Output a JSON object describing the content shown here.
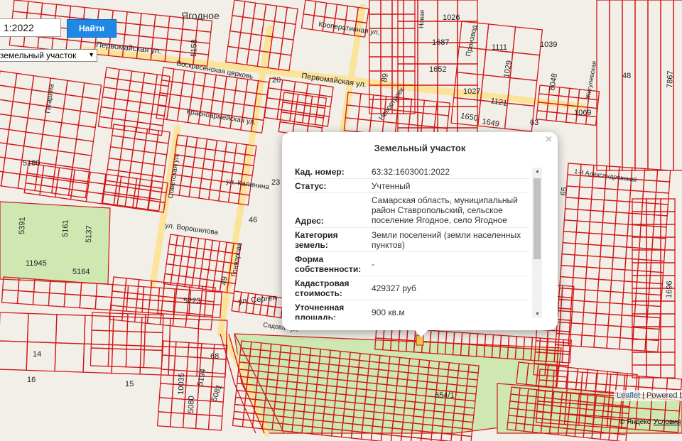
{
  "search": {
    "value": "1:2022",
    "button_label": "Найти"
  },
  "layer_select": {
    "selected": "земельный участок",
    "chevron": "chevron-down-icon"
  },
  "popup": {
    "title": "Земельный участок",
    "close": "×",
    "rows": [
      {
        "label": "Кад. номер:",
        "value": "63:32:1603001:2022"
      },
      {
        "label": "Статус:",
        "value": "Учтенный"
      },
      {
        "label": "Адрес:",
        "value": "Самарская область, муниципальный район Ставропольский, сельское поселение Ягодное, село Ягодное"
      },
      {
        "label": "Категория земель:",
        "value": "Земли поселений (земли населенных пунктов)"
      },
      {
        "label": "Форма собственности:",
        "value": "-"
      },
      {
        "label": "Кадастровая стоимость:",
        "value": "429327 руб"
      },
      {
        "label": "Уточненная площадь:",
        "value": "900 кв.м"
      }
    ]
  },
  "map": {
    "colors": {
      "parcel_border": "#d01818",
      "road": "#fce39a",
      "field": "#cfe8b2",
      "background": "#f2efe9"
    },
    "street_labels": [
      "Первомайская ул.",
      "Первомайская ул.",
      "Кооперативная ул.",
      "Красноармейская ул.",
      "Советская ул.",
      "ул. Калинина",
      "ул. Ворошилова",
      "Гагарина",
      "Гончарова",
      "ул. Сергея",
      "Садовая ул.",
      "Новая",
      "Производ",
      "Новостроек",
      "1-й Александровский",
      "Жигулевская"
    ],
    "place_labels": [
      "Ягодное",
      "Воскресенская церковь"
    ],
    "parcel_numbers": [
      "1026",
      "1687",
      "1111",
      "1039",
      "1652",
      "1029",
      "8048",
      "1027",
      "1121",
      "1650",
      "1649",
      "63",
      "1069",
      "48",
      "7867",
      "5158",
      "20",
      "89",
      "5180",
      "23",
      "46",
      "5391",
      "5161",
      "5137",
      "11945",
      "5164",
      "49",
      "5223",
      "14",
      "15",
      "16",
      "68",
      "10035",
      "5194",
      "5081",
      "5080",
      "654/1",
      "65",
      "1696",
      "1"
    ]
  },
  "attribution": {
    "leaflet": "Leaflet",
    "powered": "Powered by",
    "yandex": "© Яндекс",
    "terms": "Условия"
  }
}
